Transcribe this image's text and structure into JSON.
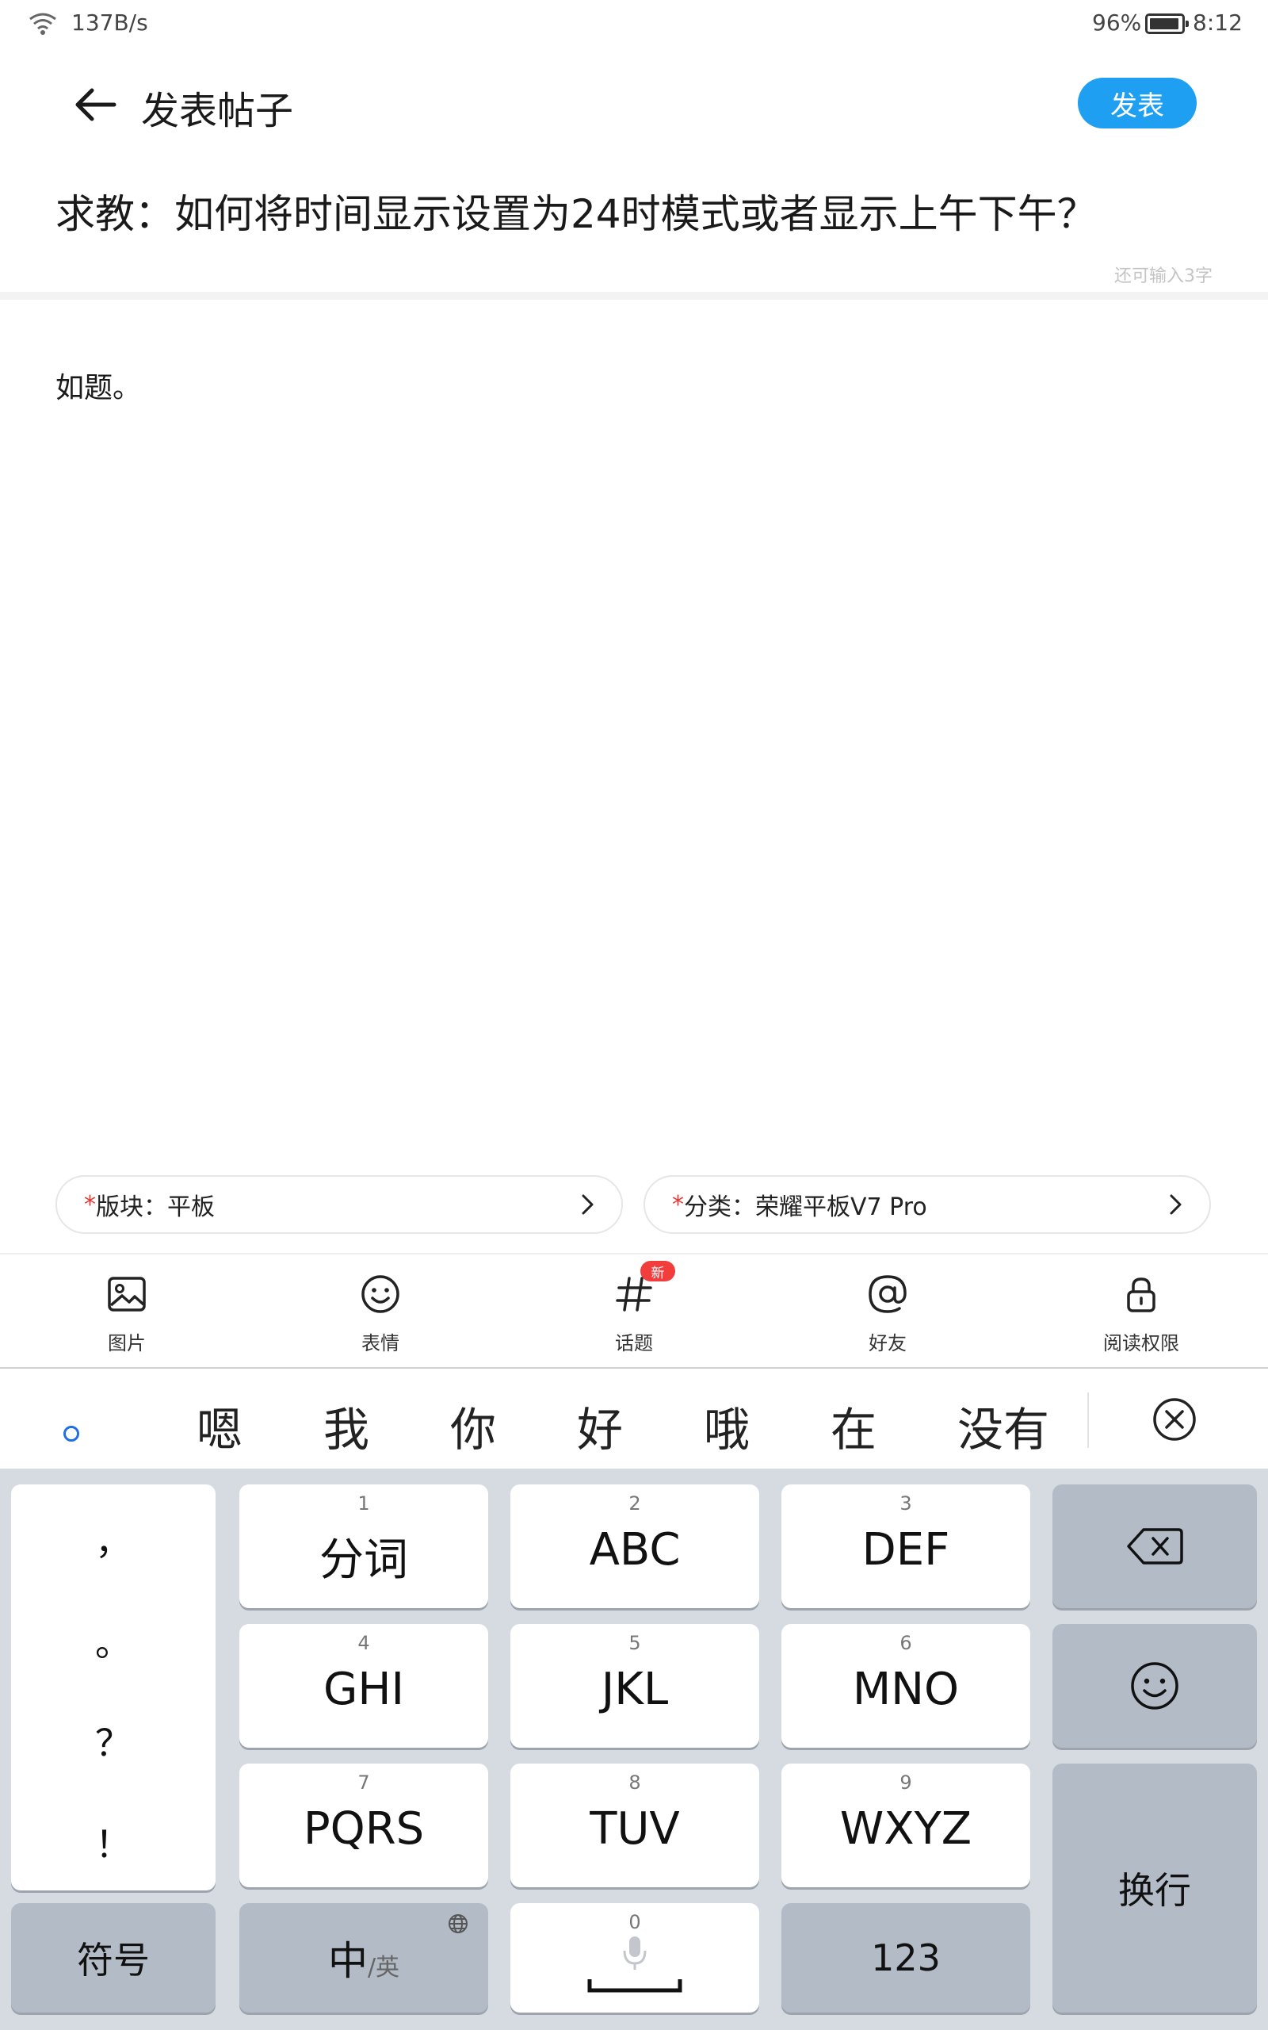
{
  "status_bar": {
    "net_speed": "137B/s",
    "battery_pct": "96%",
    "time": "8:12"
  },
  "header": {
    "title": "发表帖子",
    "publish_label": "发表"
  },
  "post": {
    "title": "求教：如何将时间显示设置为24时模式或者显示上午下午？",
    "remaining": "还可输入3字",
    "body": "如题。"
  },
  "selectors": {
    "board_required": "*",
    "board": "版块：平板",
    "category_required": "*",
    "category": "分类：荣耀平板V7 Pro"
  },
  "toolbar": {
    "items": [
      {
        "label": "图片",
        "icon": "image-icon"
      },
      {
        "label": "表情",
        "icon": "smiley-icon"
      },
      {
        "label": "话题",
        "icon": "hashtag-icon",
        "badge": "新"
      },
      {
        "label": "好友",
        "icon": "at-icon"
      },
      {
        "label": "阅读权限",
        "icon": "lock-icon"
      }
    ]
  },
  "candidates": [
    "嗯",
    "我",
    "你",
    "好",
    "哦",
    "在",
    "没有"
  ],
  "keyboard": {
    "punctuation": [
      "，",
      "。",
      "？",
      "！"
    ],
    "keys": [
      {
        "num": "1",
        "label": "分词"
      },
      {
        "num": "2",
        "label": "ABC"
      },
      {
        "num": "3",
        "label": "DEF"
      },
      {
        "num": "4",
        "label": "GHI"
      },
      {
        "num": "5",
        "label": "JKL"
      },
      {
        "num": "6",
        "label": "MNO"
      },
      {
        "num": "7",
        "label": "PQRS"
      },
      {
        "num": "8",
        "label": "TUV"
      },
      {
        "num": "9",
        "label": "WXYZ"
      }
    ],
    "symbol_label": "符号",
    "lang_main": "中",
    "lang_alt": "/英",
    "zero_num": "0",
    "num_label": "123",
    "enter_label": "换行"
  },
  "colors": {
    "accent": "#1e9ff2",
    "badge": "#f23d3d",
    "required": "#e53935",
    "keyboard_bg": "#d6dbe2"
  }
}
